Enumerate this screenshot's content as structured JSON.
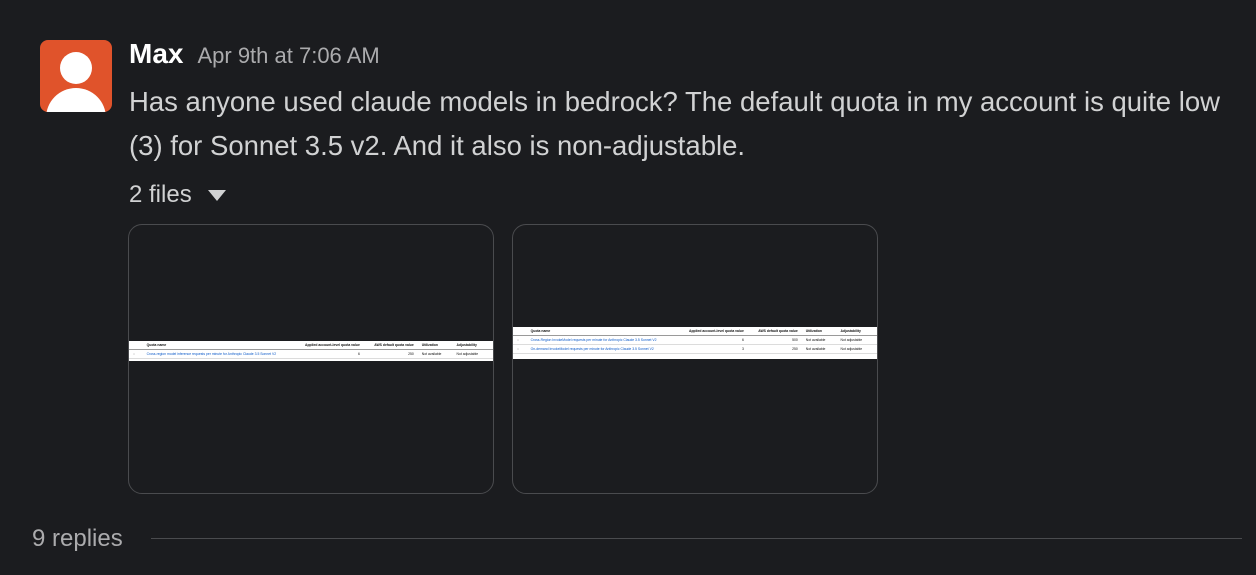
{
  "message": {
    "author": "Max",
    "timestamp": "Apr 9th at 7:06 AM",
    "text": "Has anyone used claude models in bedrock? The default quota in my account is quite low (3) for Sonnet 3.5 v2. And it also is non-adjustable.",
    "avatar_icon": "user-silhouette-icon",
    "avatar_color": "#e0532b"
  },
  "files": {
    "toggle_label": "2 files",
    "toggle_icon": "caret-down-icon",
    "items": [
      {
        "table": {
          "headers": [
            "Quota name",
            "Applied account-level quota value",
            "AWS default quota value",
            "Utilization",
            "Adjustability"
          ],
          "rows": [
            {
              "name": "Cross-region model inference requests per minute for Anthropic Claude 3.5 Sonnet V2",
              "applied": "6",
              "default": "250",
              "utilization": "Not available",
              "adjustability": "Not adjustable"
            }
          ]
        }
      },
      {
        "table": {
          "headers": [
            "Quota name",
            "Applied account-level quota value",
            "AWS default quota value",
            "Utilization",
            "Adjustability"
          ],
          "rows": [
            {
              "name": "Cross-Region InvokeModel requests per minute for Anthropic Claude 3.5 Sonnet V2",
              "applied": "6",
              "default": "500",
              "utilization": "Not available",
              "adjustability": "Not adjustable"
            },
            {
              "name": "On-demand InvokeModel requests per minute for Anthropic Claude 3.5 Sonnet V2",
              "applied": "3",
              "default": "250",
              "utilization": "Not available",
              "adjustability": "Not adjustable"
            }
          ]
        }
      }
    ]
  },
  "thread": {
    "replies_label": "9 replies"
  },
  "colors": {
    "background": "#1b1c1f",
    "link": "#0a59c9",
    "border": "#4a4b4e"
  }
}
